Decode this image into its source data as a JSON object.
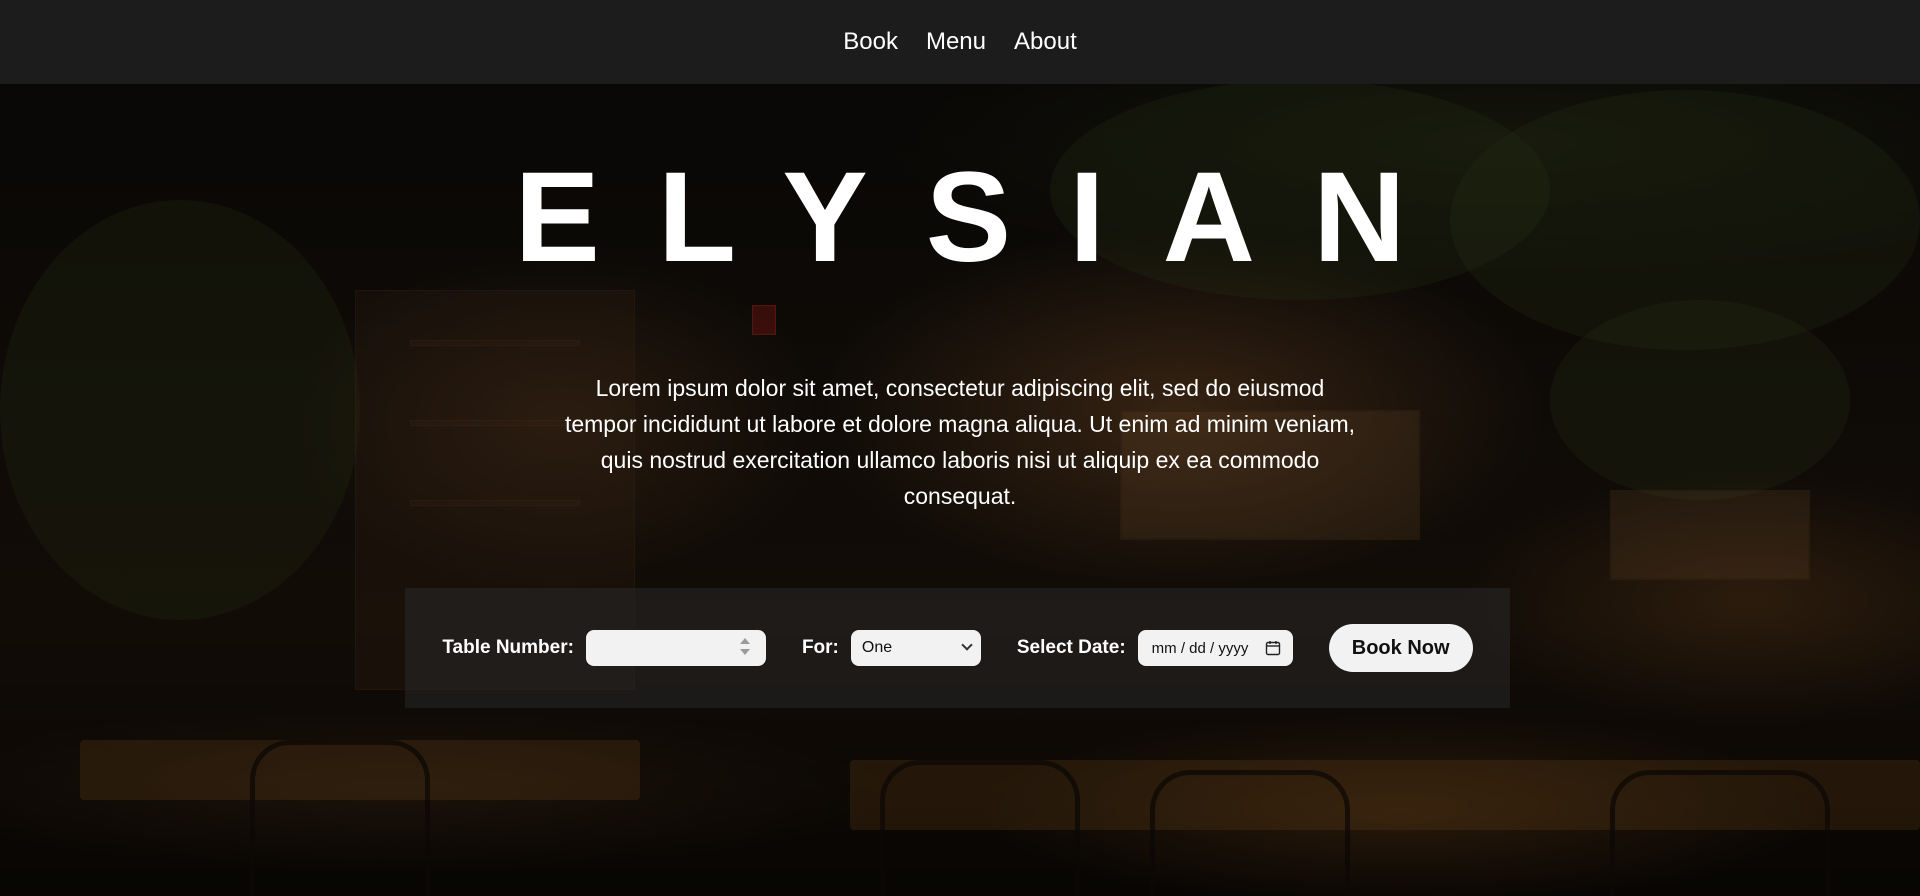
{
  "nav": {
    "items": [
      {
        "label": "Book"
      },
      {
        "label": "Menu"
      },
      {
        "label": "About"
      }
    ]
  },
  "hero": {
    "title": "ELYSIAN",
    "description": "Lorem ipsum dolor sit amet, consectetur adipiscing elit, sed do eiusmod tempor incididunt ut labore et dolore magna aliqua. Ut enim ad minim veniam, quis nostrud exercitation ullamco laboris nisi ut aliquip ex ea commodo consequat."
  },
  "booking": {
    "table_label": "Table Number:",
    "table_value": "",
    "for_label": "For:",
    "for_selected": "One",
    "date_label": "Select Date:",
    "date_placeholder": "mm / dd / yyyy",
    "submit_label": "Book Now"
  },
  "colors": {
    "navbar_bg": "#1c1c1c",
    "text": "#ffffff",
    "input_bg": "#f2f2f2"
  },
  "icons": {
    "spinner": "number-spinner-icon",
    "select": "chevron-down-icon",
    "date": "calendar-icon"
  }
}
